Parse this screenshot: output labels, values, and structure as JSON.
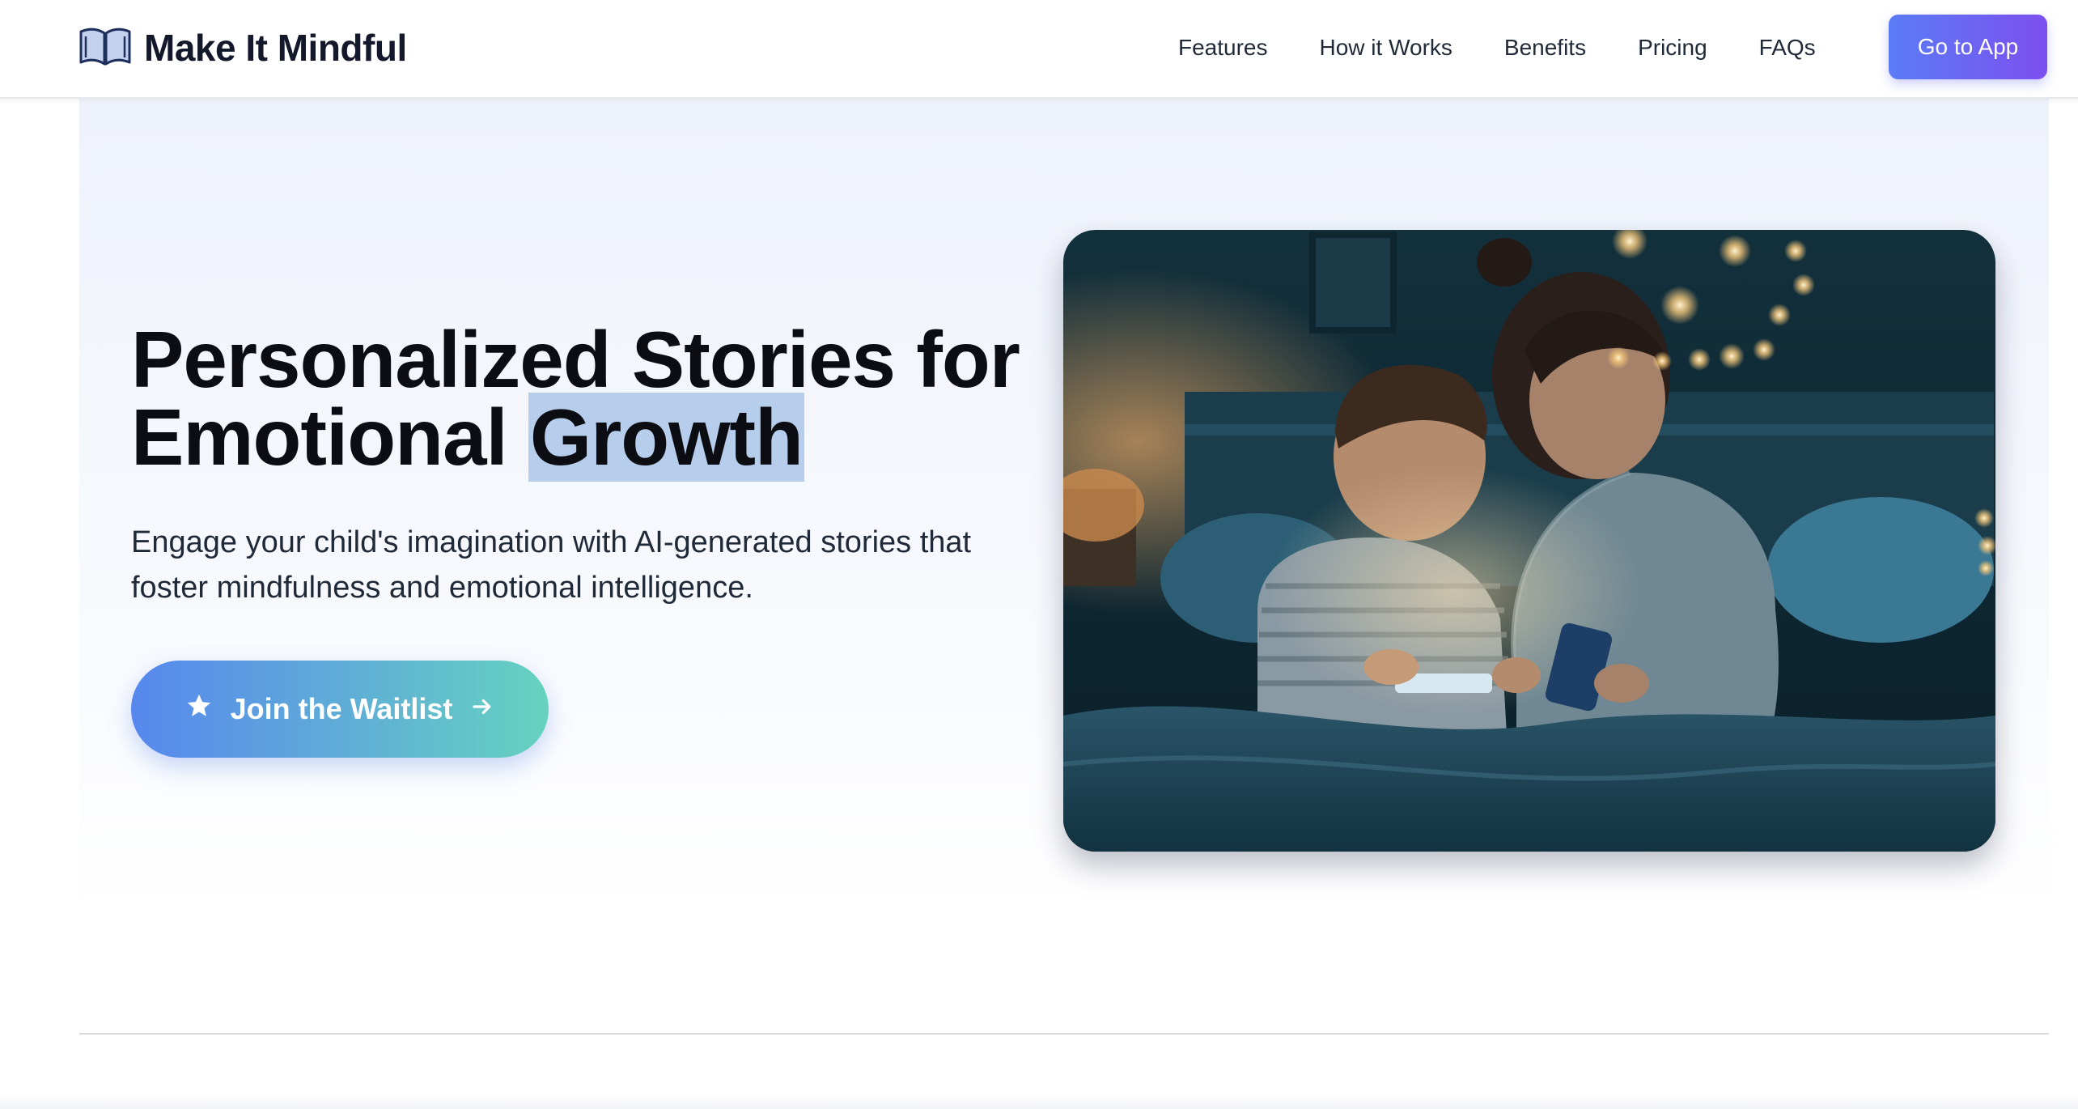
{
  "brand": {
    "name": "Make It Mindful",
    "icon": "open-book-icon"
  },
  "nav": {
    "links": [
      "Features",
      "How it Works",
      "Benefits",
      "Pricing",
      "FAQs"
    ],
    "cta": "Go to App"
  },
  "hero": {
    "title_line1": "Personalized Stories for",
    "title_line2_plain": "Emotional ",
    "title_line2_highlight": "Growth",
    "subtitle_line1": "Engage your child's imagination with AI-generated stories that",
    "subtitle_line2": "foster mindfulness and emotional intelligence.",
    "cta_label": "Join the Waitlist",
    "cta_icon_left": "star-icon",
    "cta_icon_right": "arrow-right-icon"
  },
  "colors": {
    "accent_gradient_start": "#5b7cf6",
    "accent_gradient_end": "#7c4ff0",
    "waitlist_gradient_start": "#5787ee",
    "waitlist_gradient_end": "#66d2c0",
    "highlight": "#b7cdec"
  }
}
